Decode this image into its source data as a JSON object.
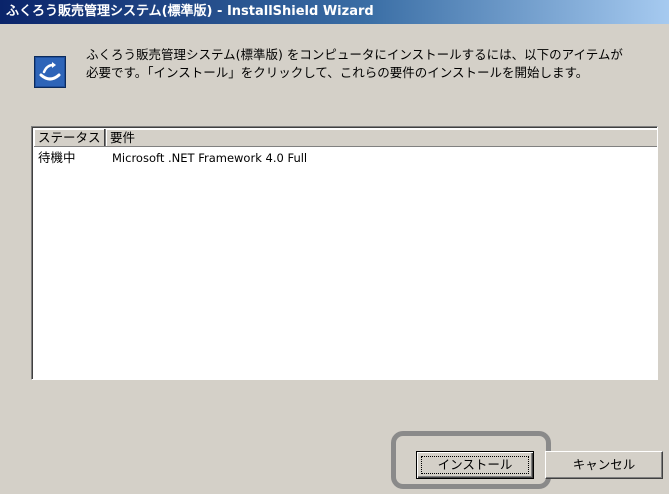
{
  "window": {
    "title": "ふくろう販売管理システム(標準版) - InstallShield Wizard"
  },
  "header": {
    "icon": "installshield-icon",
    "message_line1": "ふくろう販売管理システム(標準版) をコンピュータにインストールするには、以下のアイテムが",
    "message_line2": "必要です。「インストール」をクリックして、これらの要件のインストールを開始します。"
  },
  "requirements_list": {
    "columns": [
      "ステータス",
      "要件"
    ],
    "rows": [
      {
        "status": "待機中",
        "requirement": "Microsoft .NET Framework 4.0 Full"
      }
    ]
  },
  "buttons": {
    "install_label": "インストール",
    "cancel_label": "キャンセル"
  },
  "colors": {
    "title_bar_start": "#0a246a",
    "title_bar_end": "#a6caf0",
    "dialog_background": "#d4d0c8",
    "highlight_frame": "#8a8a8a"
  }
}
